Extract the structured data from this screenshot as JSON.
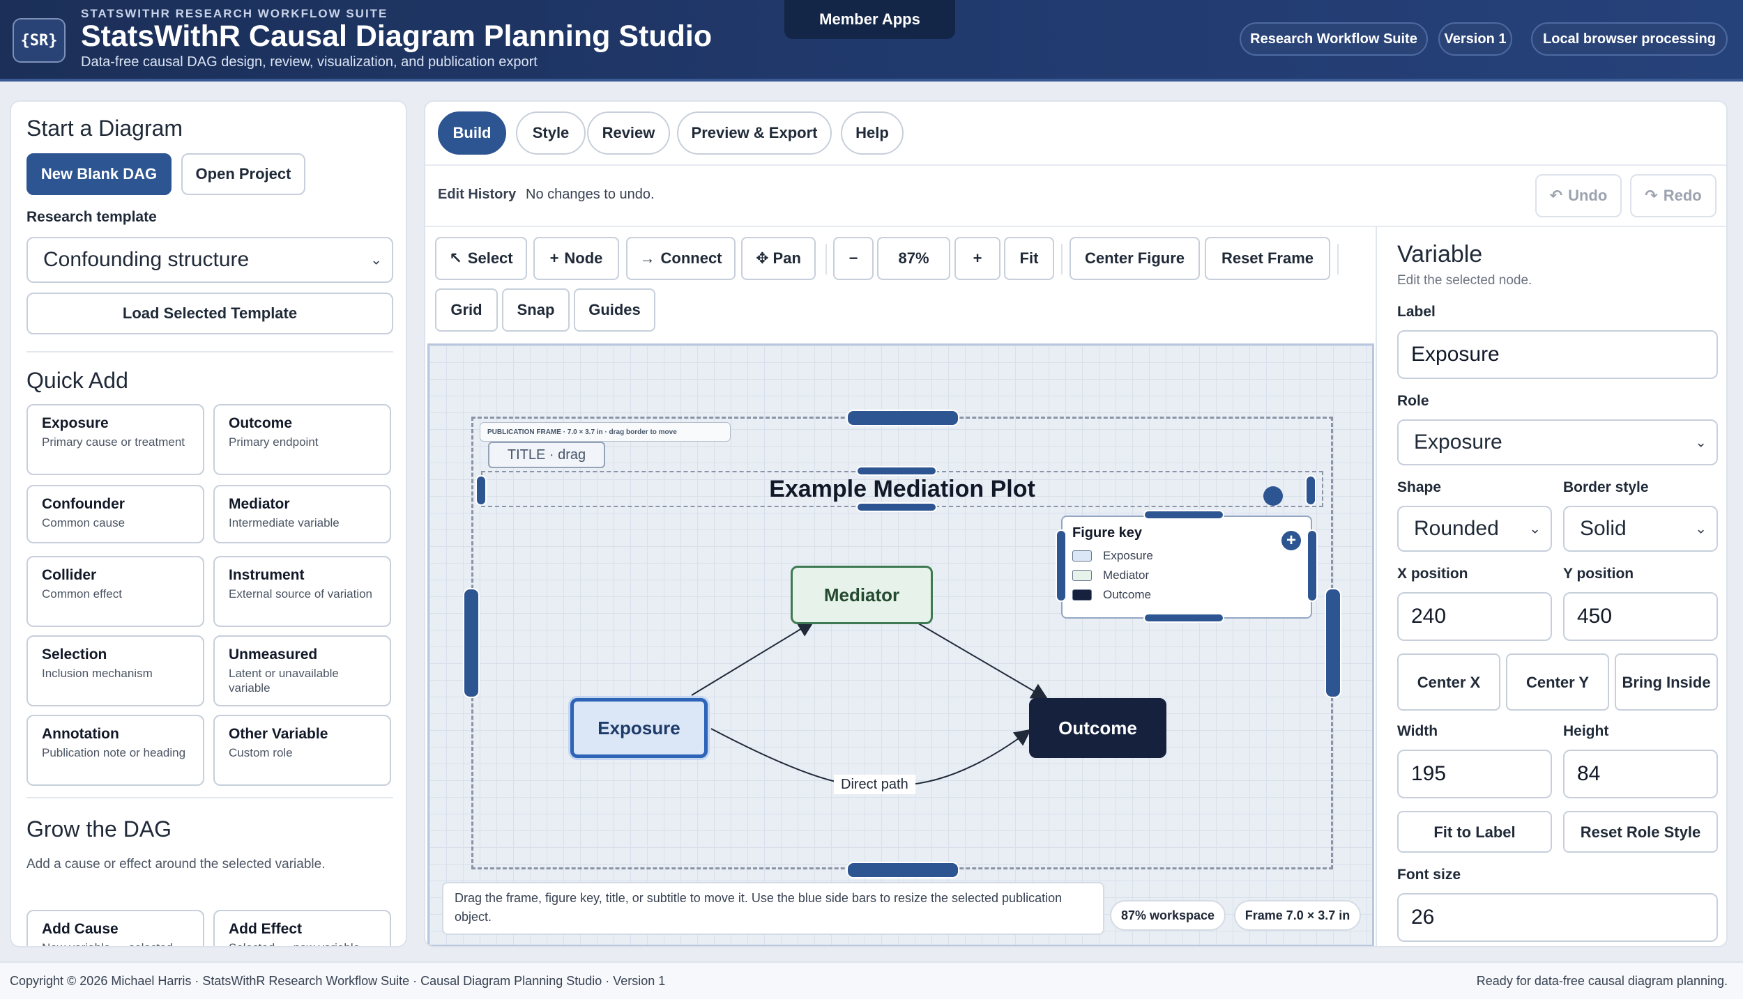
{
  "header": {
    "logo": "{SR}",
    "eyebrow": "STATSWITHR RESEARCH WORKFLOW SUITE",
    "title": "StatsWithR Causal Diagram Planning Studio",
    "subtitle": "Data-free causal DAG design, review, visualization, and publication export",
    "member_apps": "Member Apps",
    "pills": [
      "Research Workflow Suite",
      "Version 1",
      "Local browser processing"
    ]
  },
  "left": {
    "start_heading": "Start a Diagram",
    "new_blank": "New Blank DAG",
    "open_project": "Open Project",
    "template_label": "Research template",
    "template_value": "Confounding structure",
    "load_template": "Load Selected Template",
    "quick_add_heading": "Quick Add",
    "quick_add": [
      {
        "title": "Exposure",
        "desc": "Primary cause or treatment"
      },
      {
        "title": "Outcome",
        "desc": "Primary endpoint"
      },
      {
        "title": "Confounder",
        "desc": "Common cause"
      },
      {
        "title": "Mediator",
        "desc": "Intermediate variable"
      },
      {
        "title": "Collider",
        "desc": "Common effect"
      },
      {
        "title": "Instrument",
        "desc": "External source of variation"
      },
      {
        "title": "Selection",
        "desc": "Inclusion mechanism"
      },
      {
        "title": "Unmeasured",
        "desc": "Latent or unavailable variable"
      },
      {
        "title": "Annotation",
        "desc": "Publication note or heading"
      },
      {
        "title": "Other Variable",
        "desc": "Custom role"
      }
    ],
    "grow_heading": "Grow the DAG",
    "grow_desc": "Add a cause or effect around the selected variable.",
    "add_cause": "Add Cause",
    "add_cause_sub": "New variable → selected",
    "add_effect": "Add Effect",
    "add_effect_sub": "Selected → new variable"
  },
  "tabs": [
    "Build",
    "Style",
    "Review",
    "Preview & Export",
    "Help"
  ],
  "history": {
    "label": "Edit History",
    "status": "No changes to undo.",
    "undo": "Undo",
    "redo": "Redo"
  },
  "toolbar": {
    "select": "Select",
    "node": "Node",
    "connect": "Connect",
    "pan": "Pan",
    "zoom_out": "−",
    "zoom": "87%",
    "zoom_in": "+",
    "fit": "Fit",
    "center_figure": "Center Figure",
    "reset_frame": "Reset Frame",
    "grid": "Grid",
    "snap": "Snap",
    "guides": "Guides"
  },
  "canvas": {
    "frame_label": "PUBLICATION FRAME · 7.0 × 3.7 in · drag border to move",
    "title_tag": "TITLE · drag",
    "plot_title": "Example Mediation Plot",
    "key_title": "Figure key",
    "key_items": [
      {
        "label": "Exposure",
        "color": "#dbe7f7"
      },
      {
        "label": "Mediator",
        "color": "#e6f2ea"
      },
      {
        "label": "Outcome",
        "color": "#16213d"
      }
    ],
    "nodes": {
      "exposure": "Exposure",
      "mediator": "Mediator",
      "outcome": "Outcome"
    },
    "edge_label": "Direct path",
    "hint": "Drag the frame, figure key, title, or subtitle to move it. Use the blue side bars to resize the selected publication object.",
    "workspace_chip": "87% workspace",
    "frame_chip": "Frame 7.0 × 3.7 in"
  },
  "inspector": {
    "heading": "Variable",
    "sub": "Edit the selected node.",
    "label_label": "Label",
    "label_value": "Exposure",
    "role_label": "Role",
    "role_value": "Exposure",
    "shape_label": "Shape",
    "shape_value": "Rounded",
    "border_label": "Border style",
    "border_value": "Solid",
    "x_label": "X position",
    "x_value": "240",
    "y_label": "Y position",
    "y_value": "450",
    "center_x": "Center X",
    "center_y": "Center Y",
    "bring_inside": "Bring Inside",
    "width_label": "Width",
    "width_value": "195",
    "height_label": "Height",
    "height_value": "84",
    "fit_label": "Fit to Label",
    "reset_role": "Reset Role Style",
    "font_label": "Font size",
    "font_value": "26"
  },
  "footer": {
    "left": "Copyright © 2026 Michael Harris · StatsWithR Research Workflow Suite · Causal Diagram Planning Studio · Version 1",
    "right": "Ready for data-free causal diagram planning."
  }
}
